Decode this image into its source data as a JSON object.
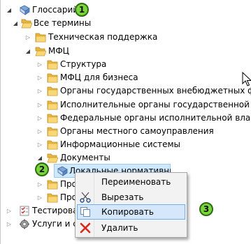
{
  "tree": {
    "root_label": "Глоссарий",
    "all_terms_label": "Все термины",
    "items": [
      {
        "label": "Техническая поддержка"
      },
      {
        "label": "МФЦ"
      },
      {
        "label": "Структура"
      },
      {
        "label": "МФЦ для бизнеса"
      },
      {
        "label": "Органы государственных внебюджетных фондов"
      },
      {
        "label": "Исполнительные органы государственной власти"
      },
      {
        "label": "Федеральные органы исполнительной власти"
      },
      {
        "label": "Органы местного самоуправления"
      },
      {
        "label": "Информационные системы"
      },
      {
        "label": "Документы"
      },
      {
        "label": "Локальные нормативные акты"
      },
      {
        "label": "Процесс"
      },
      {
        "label": "Прочее"
      }
    ],
    "testing_label": "Тестирование",
    "services_label": "Услуги и сервис"
  },
  "context_menu": {
    "rename": "Переименовать",
    "cut": "Вырезать",
    "copy": "Копировать",
    "delete": "Удалить"
  },
  "badges": [
    "1",
    "2",
    "3"
  ],
  "colors": {
    "selection": "#cde8ff",
    "menu_highlight": "#d5e8fb",
    "badge": "#7ad53c",
    "folder": "#f0c34c"
  }
}
